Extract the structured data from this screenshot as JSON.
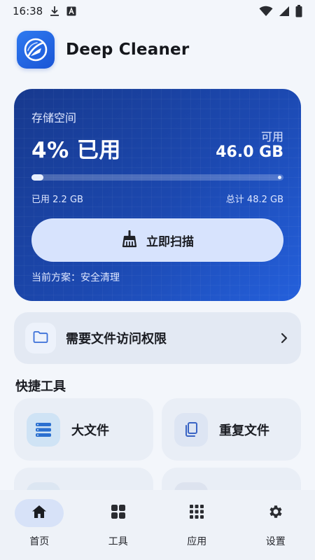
{
  "status_bar": {
    "time": "16:38"
  },
  "header": {
    "app_title": "Deep Cleaner"
  },
  "storage": {
    "label": "存储空间",
    "used_percent_text": "4% 已用",
    "used_fraction": 0.046,
    "available_label": "可用",
    "available_value": "46.0 GB",
    "used_detail": "已用 2.2 GB",
    "total_detail": "总计 48.2 GB",
    "scan_button_label": "立即扫描",
    "plan_text": "当前方案：安全清理"
  },
  "permission": {
    "label": "需要文件访问权限"
  },
  "quick_tools": {
    "title": "快捷工具",
    "items": [
      {
        "label": "大文件",
        "icon": "stack-icon"
      },
      {
        "label": "重复文件",
        "icon": "copy-icon"
      }
    ]
  },
  "bottom_nav": {
    "items": [
      {
        "label": "首页",
        "icon": "home-icon",
        "active": true
      },
      {
        "label": "工具",
        "icon": "grid-icon",
        "active": false
      },
      {
        "label": "应用",
        "icon": "apps-icon",
        "active": false
      },
      {
        "label": "设置",
        "icon": "gear-icon",
        "active": false
      }
    ]
  },
  "colors": {
    "accent": "#1c49b1",
    "card_gradient_start": "#17398e",
    "card_gradient_end": "#2460dc",
    "scan_button": "#d7e3fd",
    "background": "#f3f6fb"
  }
}
